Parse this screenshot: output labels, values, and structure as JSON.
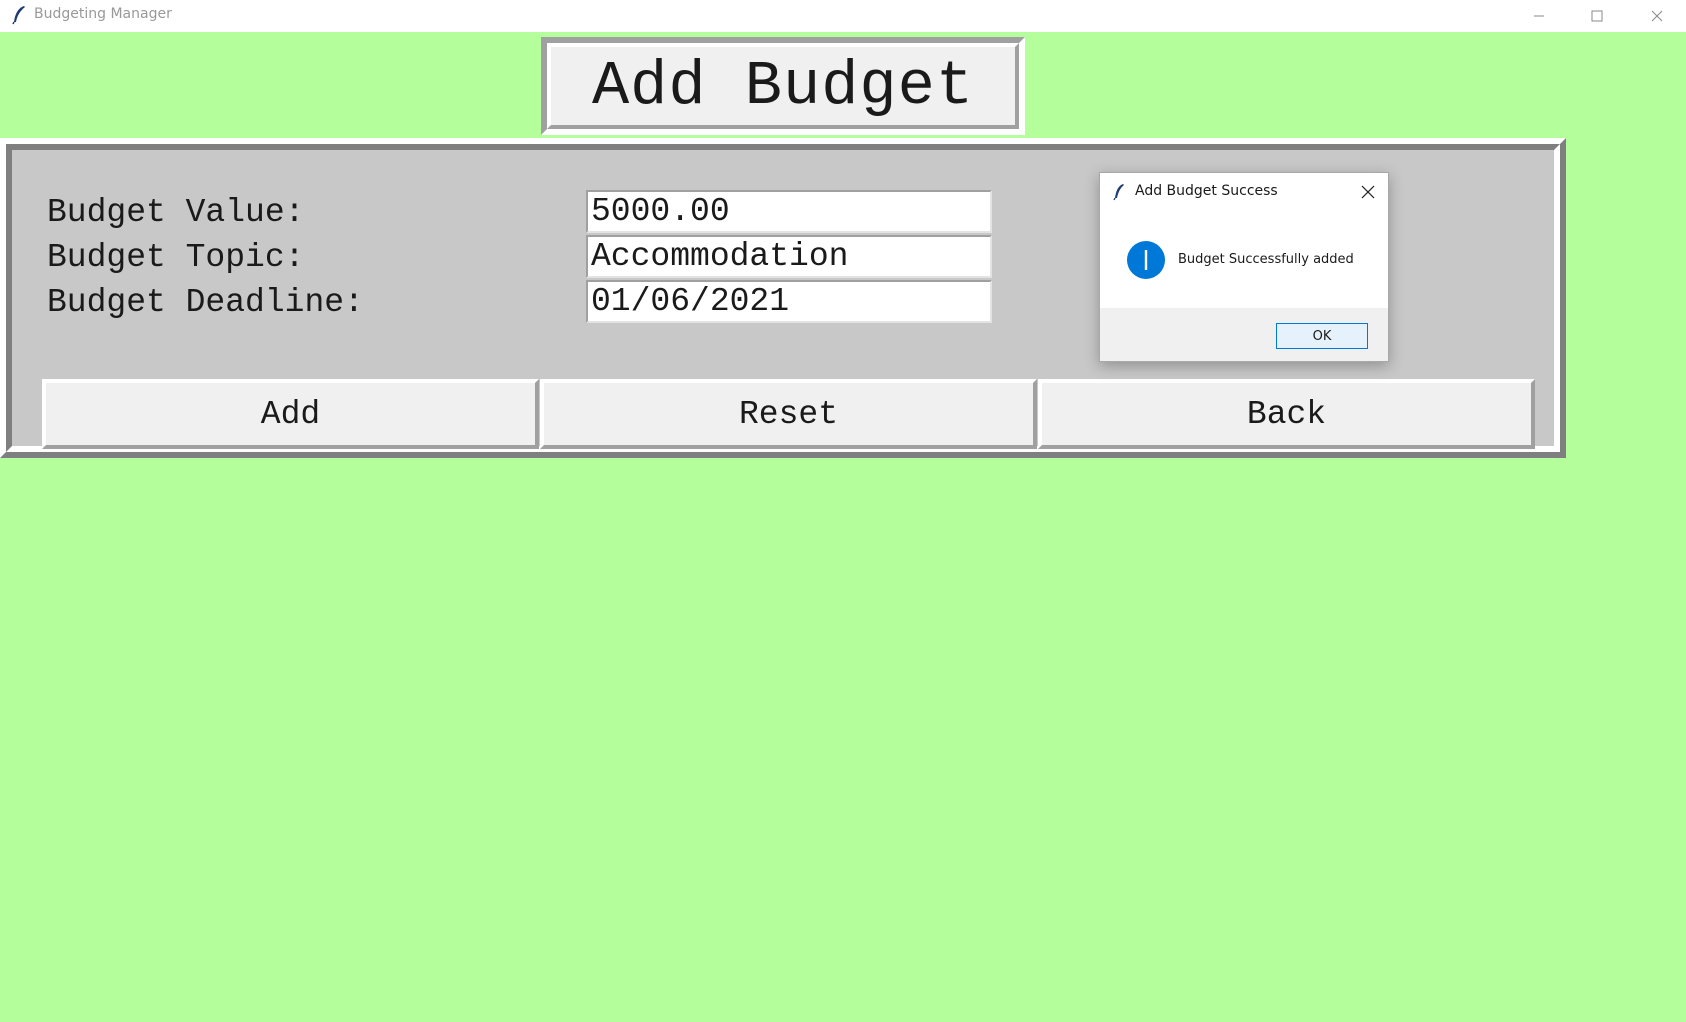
{
  "window": {
    "title": "Budgeting Manager",
    "icon": "feather-icon"
  },
  "heading": {
    "title": "Add Budget"
  },
  "form": {
    "fields": [
      {
        "label": "Budget Value:",
        "value": "5000.00"
      },
      {
        "label": "Budget Topic:",
        "value": "Accommodation"
      },
      {
        "label": "Budget Deadline:",
        "value": "01/06/2021"
      }
    ],
    "buttons": {
      "add": "Add",
      "reset": "Reset",
      "back": "Back"
    }
  },
  "dialog": {
    "title": "Add Budget Success",
    "message": "Budget Successfully added",
    "ok_label": "OK",
    "icon": "info-icon"
  },
  "colors": {
    "background": "#b4ff9b",
    "panel": "#c8c8c8",
    "button": "#f0f0f0",
    "info_blue": "#0078d7"
  }
}
